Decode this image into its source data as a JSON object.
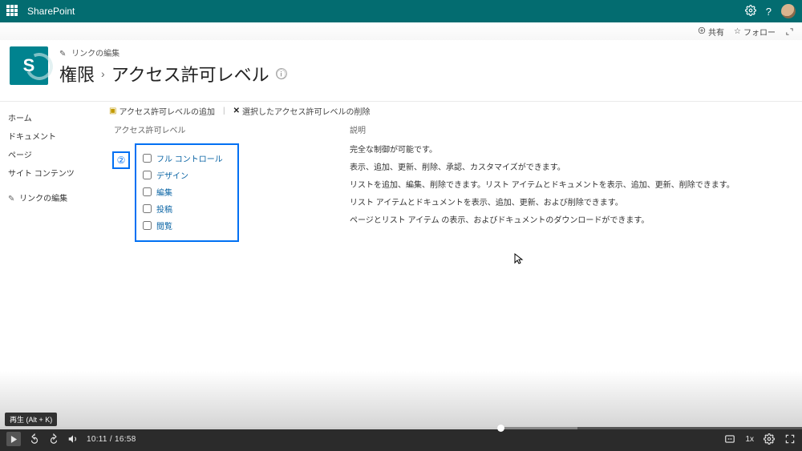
{
  "brand": "SharePoint",
  "topbar": {
    "settings_icon": "gear",
    "help_icon": "?",
    "share_label": "共有",
    "follow_label": "フォロー"
  },
  "header": {
    "site_initial": "S",
    "edit_link_label": "リンクの編集",
    "title_perm": "権限",
    "title_sep": "›",
    "title_levels": "アクセス許可レベル",
    "info_icon": "ⓘ"
  },
  "sidenav": {
    "items": [
      {
        "label": "ホーム"
      },
      {
        "label": "ドキュメント"
      },
      {
        "label": "ページ"
      },
      {
        "label": "サイト コンテンツ"
      }
    ],
    "edit_link_label": "リンクの編集"
  },
  "ribbon": {
    "add_label": "アクセス許可レベルの追加",
    "delete_label": "選択したアクセス許可レベルの削除"
  },
  "columns": {
    "level_header": "アクセス許可レベル",
    "desc_header": "説明"
  },
  "annotation": {
    "num": "②"
  },
  "levels": [
    {
      "name": "フル コントロール",
      "desc": "完全な制御が可能です。"
    },
    {
      "name": "デザイン",
      "desc": "表示、追加、更新、削除、承認、カスタマイズができます。"
    },
    {
      "name": "編集",
      "desc": "リストを追加、編集、削除できます。リスト アイテムとドキュメントを表示、追加、更新、削除できます。"
    },
    {
      "name": "投稿",
      "desc": "リスト アイテムとドキュメントを表示、追加、更新、および削除できます。"
    },
    {
      "name": "閲覧",
      "desc": "ページとリスト アイテム の表示、およびドキュメントのダウンロードができます。"
    }
  ],
  "video": {
    "hint": "再生 (Alt + K)",
    "time_current": "10:11",
    "time_total": "16:58",
    "speed": "1x"
  }
}
